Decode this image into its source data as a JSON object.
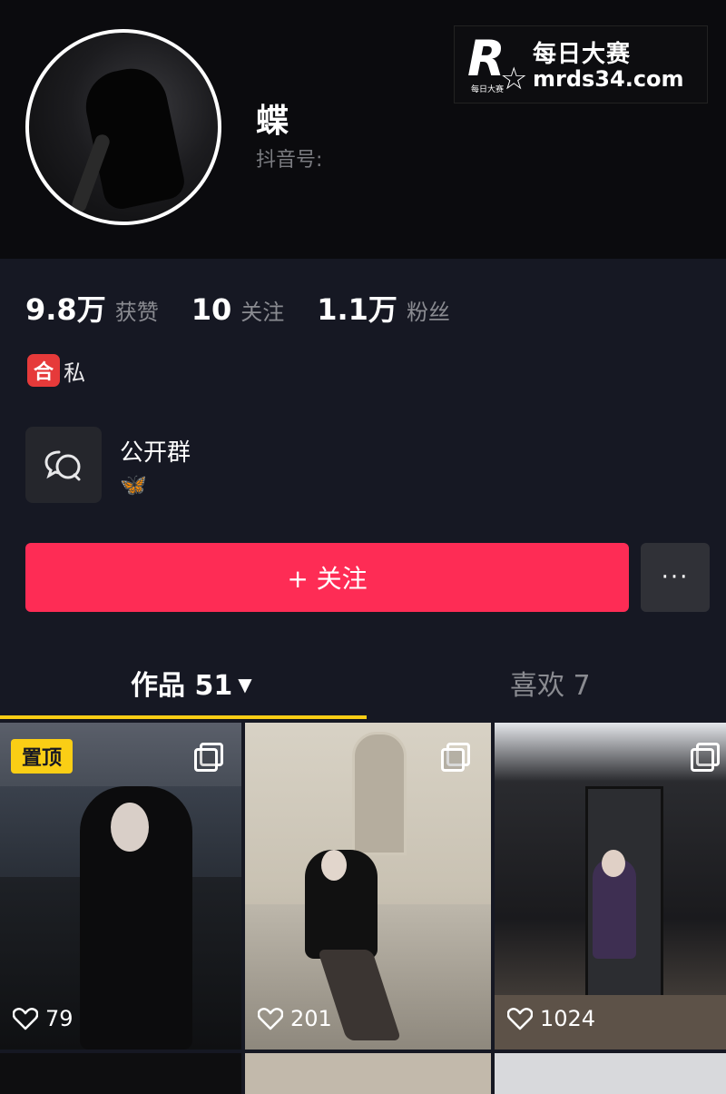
{
  "profile": {
    "nickname": "蝶",
    "douyin_id_label": "抖音号:"
  },
  "watermark": {
    "logo_letter": "R",
    "logo_small": "每日大赛",
    "name": "每日大赛",
    "url": "mrds34.com"
  },
  "stats": [
    {
      "value": "9.8万",
      "label": "获赞"
    },
    {
      "value": "10",
      "label": "关注"
    },
    {
      "value": "1.1万",
      "label": "粉丝"
    }
  ],
  "tag": {
    "badge": "合",
    "text": "私"
  },
  "group": {
    "name": "公开群",
    "emoji": "🦋",
    "icon": "chat-bubbles-icon"
  },
  "actions": {
    "follow_label": "+ 关注",
    "more_label": "···"
  },
  "tabs": {
    "works_label": "作品 51",
    "works_caret": "▼",
    "likes_label": "喜欢 7"
  },
  "videos": [
    {
      "pinned_label": "置顶",
      "likes": "79"
    },
    {
      "likes": "201"
    },
    {
      "likes": "1024"
    }
  ],
  "colors": {
    "follow_button": "#fe2c55",
    "tab_indicator": "#face15",
    "background": "#161823"
  }
}
